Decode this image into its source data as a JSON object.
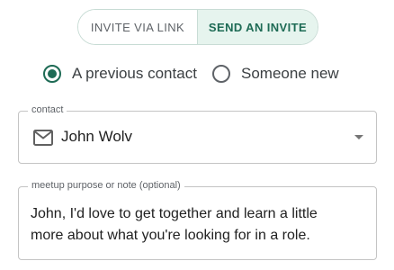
{
  "invite_toggle": {
    "link_label": "INVITE VIA LINK",
    "send_label": "SEND AN INVITE"
  },
  "recipient_type": {
    "previous_label": "A previous contact",
    "new_label": "Someone new",
    "selected": "A previous contact"
  },
  "contact_field": {
    "label": "contact",
    "value": "John Wolv",
    "icon": "mail-icon"
  },
  "note_field": {
    "label": "meetup purpose or note (optional)",
    "value": "John, I'd love to get together and learn a little\nmore about what you're looking for in a role."
  },
  "colors": {
    "accent": "#1e6b55",
    "accent_bg": "#e6f4ee",
    "border": "#c4c4c4"
  }
}
